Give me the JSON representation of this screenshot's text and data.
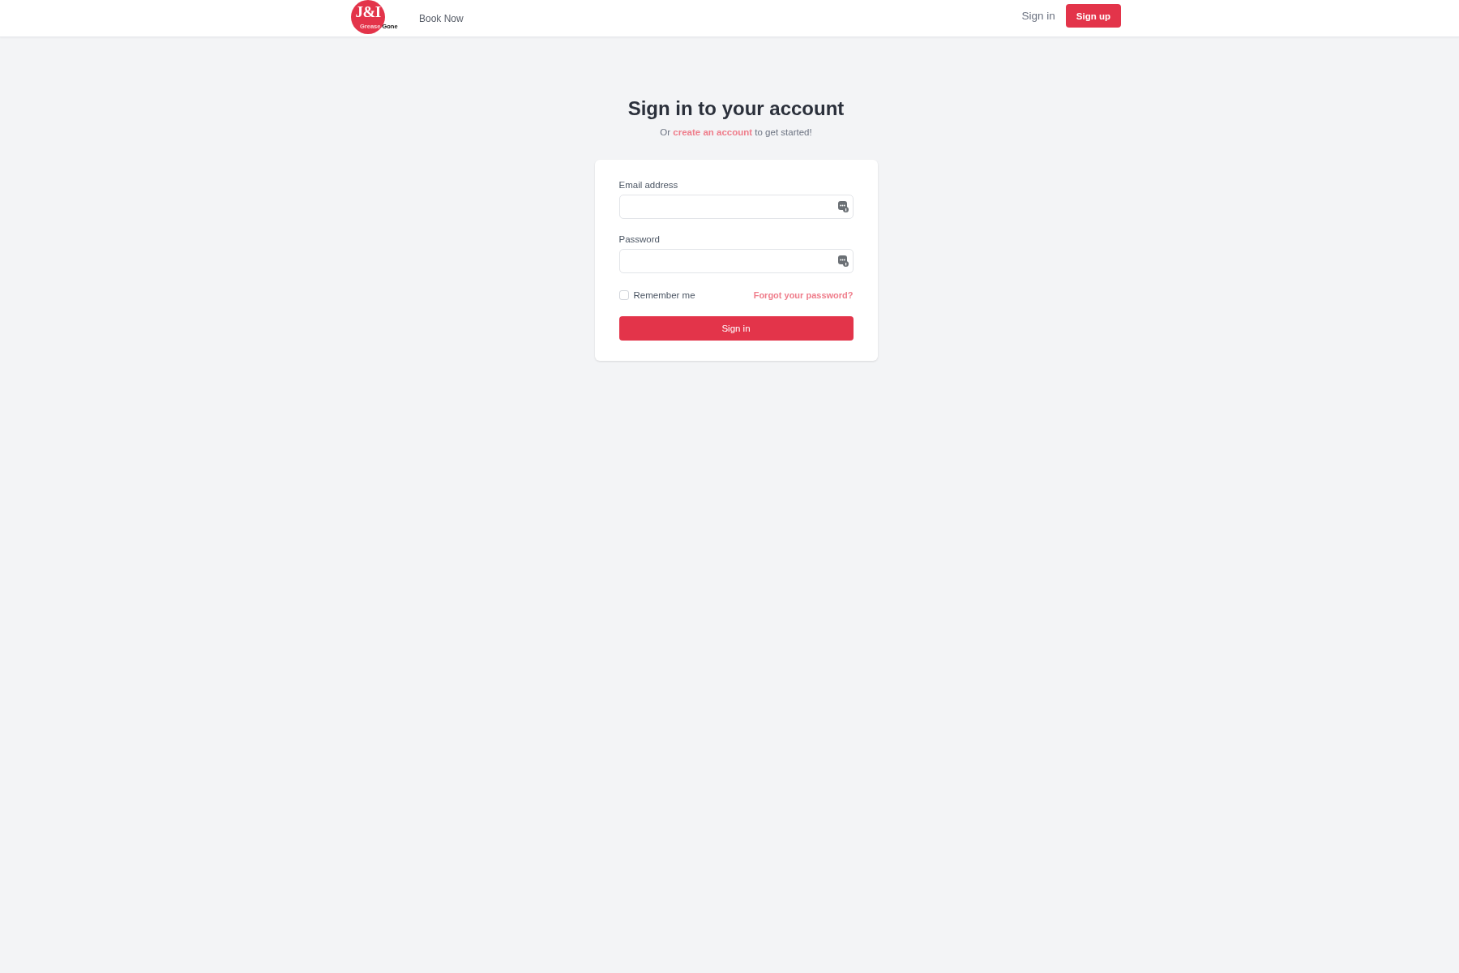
{
  "header": {
    "logo": {
      "mark": "J&I",
      "tagline": [
        "Grease",
        "Gone"
      ]
    },
    "nav_links": [
      {
        "label": "Book Now"
      }
    ],
    "sign_in_link": "Sign in",
    "sign_up_button": "Sign up"
  },
  "heading": {
    "title": "Sign in to your account",
    "subtitle_before": "Or",
    "subtitle_link": "create an account",
    "subtitle_after": "to get started!"
  },
  "form": {
    "fields": [
      {
        "label": "Email address"
      },
      {
        "label": "Password"
      }
    ],
    "remember_me": {
      "label": "Remember me",
      "checked": false
    },
    "forgot_link": "Forgot your password?",
    "submit_button": "Sign in"
  }
}
